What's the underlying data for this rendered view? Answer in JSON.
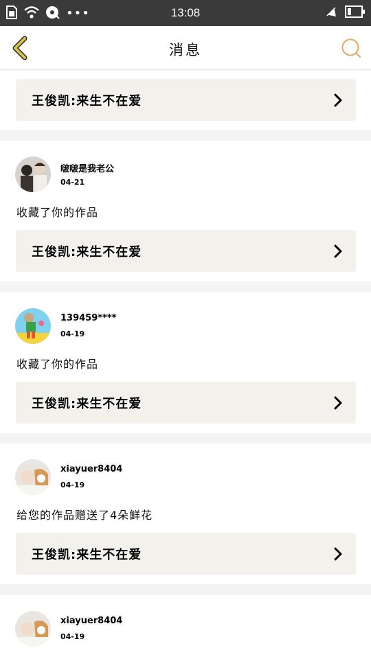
{
  "status_bar": {
    "time": "13:08",
    "dots": "•••",
    "icons": [
      "sim-icon",
      "wifi-icon",
      "music-icon",
      "mute-icon",
      "battery-icon"
    ]
  },
  "header": {
    "title": "消息",
    "back_icon": "chevron-left-icon",
    "search_icon": "search-icon"
  },
  "colors": {
    "accent": "#e8a867",
    "back_arrow": "#c9b73a",
    "card_bg": "#ffffff",
    "work_bg": "#f2f1ec",
    "page_bg": "#f4f4f4"
  },
  "messages": [
    {
      "work_title": "王俊凯:来生不在爱"
    },
    {
      "username": "啵啵是我老公",
      "date": "04-21",
      "action": "收藏了你的作品",
      "work_title": "王俊凯:来生不在爱"
    },
    {
      "username": "139459****",
      "date": "04-19",
      "action": "收藏了你的作品",
      "work_title": "王俊凯:来生不在爱"
    },
    {
      "username": "xiayuer8404",
      "date": "04-19",
      "action": "给您的作品赠送了4朵鲜花",
      "work_title": "王俊凯:来生不在爱"
    },
    {
      "username": "xiayuer8404",
      "date": "04-19"
    }
  ]
}
